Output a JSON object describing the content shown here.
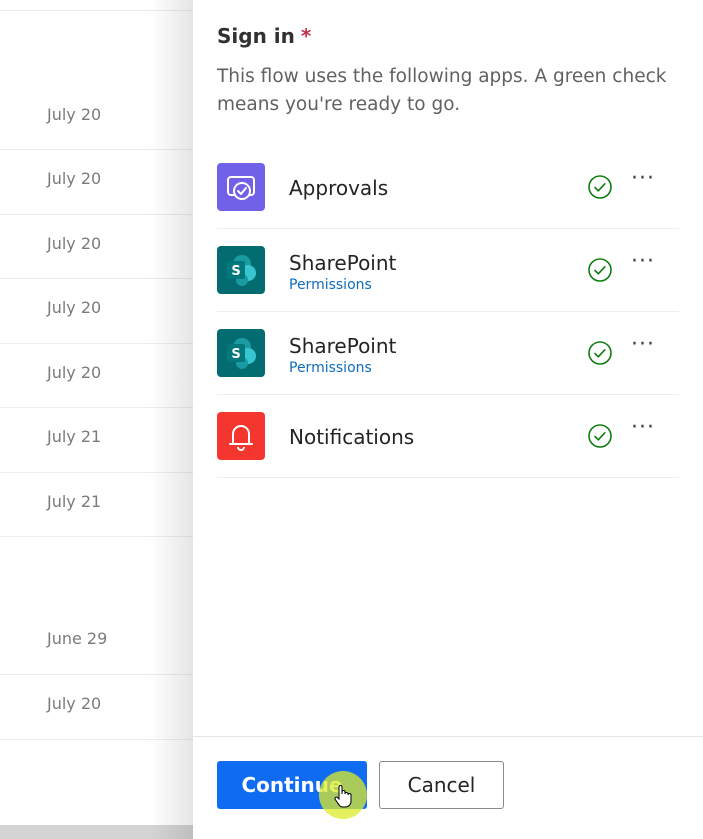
{
  "background": {
    "dates": [
      "July 20",
      "July 20",
      "July 20",
      "July 20",
      "July 20",
      "July 21",
      "July 21",
      "June 29",
      "July 20"
    ]
  },
  "panel": {
    "title": "Sign in",
    "required_mark": "*",
    "description": "This flow uses the following apps. A green check means you're ready to go.",
    "apps": [
      {
        "name": "Approvals",
        "link": "",
        "icon": "approvals-icon",
        "color": "#7160e8"
      },
      {
        "name": "SharePoint",
        "link": "Permissions",
        "icon": "sharepoint-icon",
        "color": "#036c70"
      },
      {
        "name": "SharePoint",
        "link": "Permissions",
        "icon": "sharepoint-icon",
        "color": "#036c70"
      },
      {
        "name": "Notifications",
        "link": "",
        "icon": "bell-icon",
        "color": "#f4362f"
      }
    ],
    "more_label": "···",
    "continue_label": "Continue",
    "cancel_label": "Cancel"
  },
  "colors": {
    "primary": "#0f6cf2",
    "check": "#107c10",
    "required": "#c4314b"
  }
}
